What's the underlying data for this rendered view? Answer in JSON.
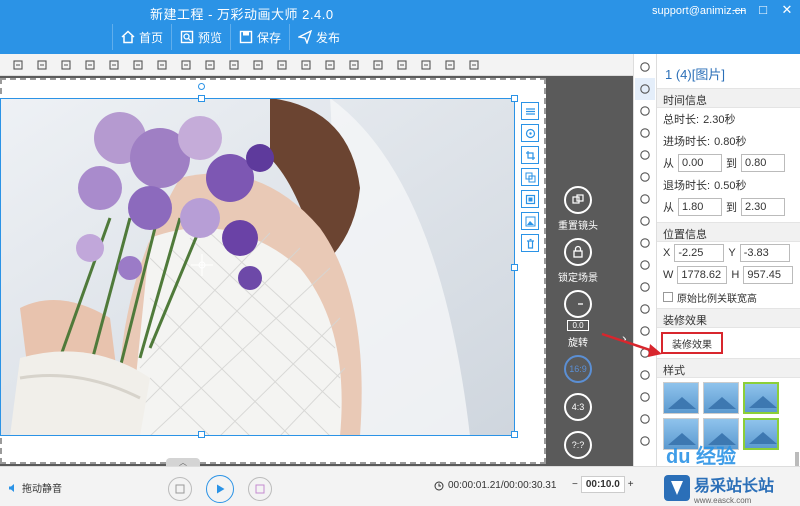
{
  "app": {
    "title": "新建工程 - 万彩动画大师 2.4.0",
    "support": "support@animiz.cn"
  },
  "nav": {
    "home": "首页",
    "preview": "预览",
    "save": "保存",
    "publish": "发布"
  },
  "window": {
    "min": "—",
    "max": "□",
    "close": "✕"
  },
  "toolbar_icons": [
    "copy-icon",
    "delete-icon",
    "paint-icon",
    "align-left-icon",
    "align-center-icon",
    "align-right-icon",
    "frame-icon",
    "align-top-icon",
    "align-middle-icon",
    "align-bottom-icon",
    "distribute-h-icon",
    "distribute-v-icon",
    "zoom-in-icon",
    "zoom-out-icon",
    "lock-icon",
    "duplicate-icon",
    "paste-icon",
    "undo-icon",
    "redo-icon",
    "transfer-icon"
  ],
  "camera": {
    "reset_label": "重置镜头",
    "lock_label": "锁定场景",
    "rotate_value": "0.0",
    "rotate_label": "旋转",
    "ratio_169": "16:9",
    "ratio_43": "4:3",
    "ratio_custom": "?:?"
  },
  "bottom": {
    "mute_label": "拖动静音",
    "time": "00:00:01.21/00:00:30.31",
    "zoom_minus": "−",
    "zoom_value": "00:10.0",
    "zoom_plus": "+"
  },
  "panel": {
    "title": "1 (4)[图片]",
    "time_section": "时间信息",
    "total_label": "总时长:",
    "total_value": "2.30秒",
    "in_label": "进场时长:",
    "in_value": "0.80秒",
    "from_label": "从",
    "to_label": "到",
    "in_from": "0.00",
    "in_to": "0.80",
    "out_label": "退场时长:",
    "out_value": "0.50秒",
    "out_from": "1.80",
    "out_to": "2.30",
    "pos_section": "位置信息",
    "x_label": "X",
    "x_value": "-2.25",
    "y_label": "Y",
    "y_value": "-3.83",
    "w_label": "W",
    "w_value": "1778.62",
    "h_label": "H",
    "h_value": "957.45",
    "ratio_check": "原始比例关联宽高",
    "effect_section": "装修效果",
    "effect_button": "装修效果",
    "style_section": "样式"
  },
  "watermark": {
    "brand": "du 经验",
    "site": "易采站长站",
    "site_url": "www.easck.com"
  },
  "colors": {
    "titlebar": "#2b93e6",
    "accent": "#2b93e6",
    "highlight_red": "#d8262d"
  }
}
